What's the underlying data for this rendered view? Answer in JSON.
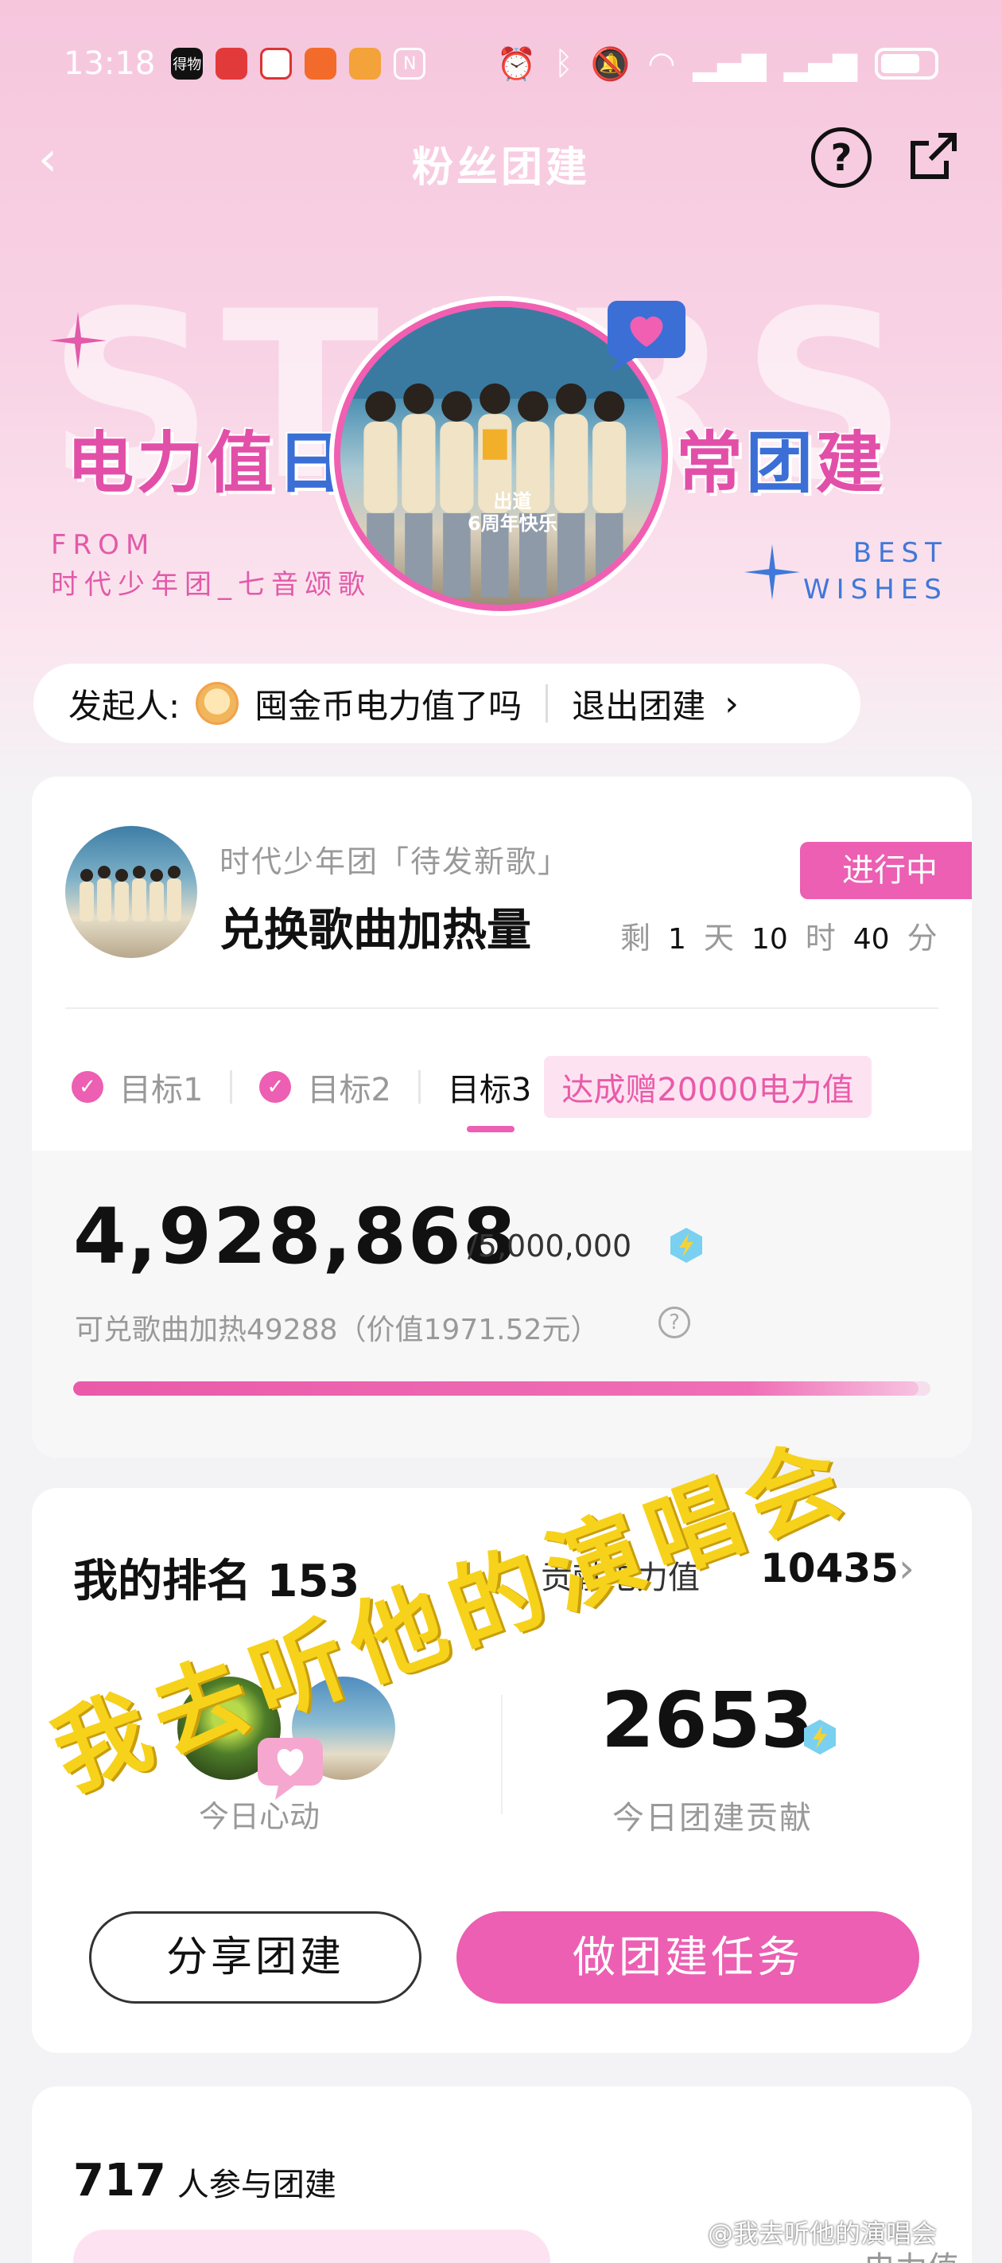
{
  "status_bar": {
    "time": "13:18",
    "apps": [
      "得物",
      "app",
      "app",
      "app",
      "app"
    ]
  },
  "nav": {
    "back_icon": "back-arrow-icon",
    "title": "粉丝团建",
    "help_icon": "help-icon",
    "share_icon": "share-icon"
  },
  "hero": {
    "bg_text": "STARS TEAM",
    "title_left_pink": "电力值",
    "title_left_blue": "日",
    "title_right_pink": "常",
    "title_right_blue": "团",
    "title_right_pink2": "建",
    "from_line1": "FROM",
    "from_line2": "时代少年团_七音颂歌",
    "best_line1": "BEST",
    "best_line2": "WISHES",
    "photo_caption_1": "出道",
    "photo_caption_2": "6周年快乐"
  },
  "initiator": {
    "label": "发起人:",
    "name": "囤金币电力值了吗",
    "quit_label": "退出团建"
  },
  "task": {
    "subtitle": "时代少年团「待发新歌」",
    "title": "兑换歌曲加热量",
    "status": "进行中",
    "countdown": {
      "prefix": "剩",
      "days": "1",
      "day_unit": "天",
      "hours": "10",
      "hour_unit": "时",
      "minutes": "40",
      "minute_unit": "分"
    },
    "goals": [
      {
        "label": "目标1",
        "done": true
      },
      {
        "label": "目标2",
        "done": true
      },
      {
        "label": "目标3",
        "done": false
      }
    ],
    "reward": "达成赠20000电力值",
    "current": "4,928,868",
    "target": "/5,000,000",
    "exchange_text": "可兑歌曲加热49288（价值1971.52元）",
    "progress_fraction": 0.9858
  },
  "rank": {
    "label": "我的排名",
    "value": "153",
    "contrib_label": "贡献电力值",
    "contrib_value": "10435",
    "today_heart_label": "今日心动",
    "today_value": "2653",
    "today_contrib_label": "今日团建贡献",
    "share_btn": "分享团建",
    "task_btn": "做团建任务"
  },
  "participants": {
    "count": "717",
    "label": "人参与团建",
    "power_label": "电力值"
  },
  "overlay": {
    "watermark": "我去听他的演唱会",
    "weibo_mark": "@我去听他的演唱会"
  },
  "colors": {
    "accent": "#ec5fb2",
    "blue_accent": "#3b6fd6",
    "watermark": "#f7d21a"
  }
}
